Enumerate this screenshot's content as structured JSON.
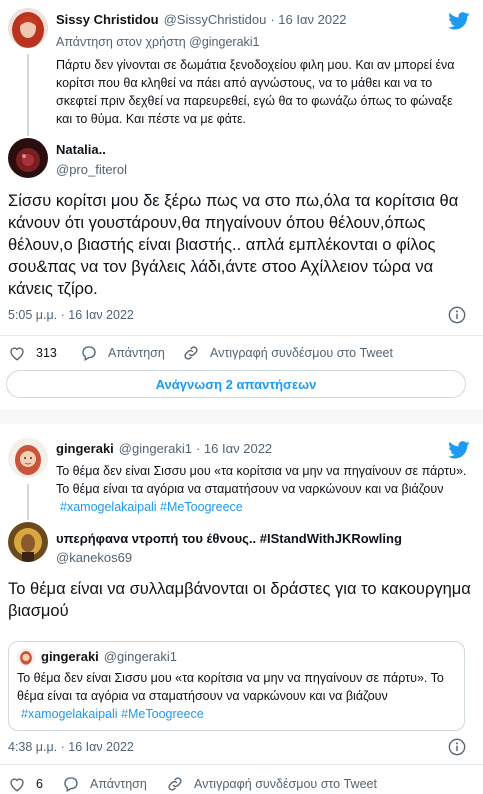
{
  "tweet1": {
    "name": "Sissy Christidou",
    "handle": "@SissyChristidou",
    "date": "· 16 Ιαν 2022",
    "reply_to": "Απάντηση στον χρήστη @gingeraki1",
    "text": "Πάρτυ δεν γίνονται σε δωμάτια ξενοδοχείου φιλη μου. Και αν μπορεί ένα κορίτσι που θα κληθεί να πάει από αγνώστους, να το μάθει και να το σκεφτεί πριν δεχθεί να παρευρεθεί, εγώ θα το φωνάζω όπως το φώναξε και το θύμα. Και πέστε να με φάτε."
  },
  "tweet2": {
    "name": "Natalia..",
    "handle": "@pro_fiterol",
    "text": "Σίσσυ κορίτσι μου δε ξέρω πως να στο πω,όλα τα κορίτσια θα κάνουν ότι γουστάρουν,θα πηγαίνουν όπου θέλουν,όπως θέλουν,ο βιαστής είναι βιαστής.. απλά εμπλέκονται ο φίλος σου&πας να τον βγάλεις λάδι,άντε στοο Αχίλλειον τώρα να κάνεις τζίρο.",
    "timestamp": "5:05 μ.μ. · 16 Ιαν 2022",
    "likes": "313",
    "reply_label": "Απάντηση",
    "copy_label": "Αντιγραφή συνδέσμου στο Tweet",
    "read_replies": "Ανάγνωση 2 απαντήσεων"
  },
  "tweet3": {
    "name": "gingeraki",
    "handle": "@gingeraki1",
    "date": "· 16 Ιαν 2022",
    "text": "Το θέμα δεν είναι Σισσυ μου «τα κορίτσια να μην να πηγαίνουν σε πάρτυ». Το θέμα είναι τα αγόρια να σταματήσουν να ναρκώνουν και να βιάζουν",
    "hashtags": "#xamogelakaipali #MeToogreece"
  },
  "tweet4": {
    "name": "υπερήφανα ντροπή του έθνους.. #IStandWithJKRowling",
    "handle": "@kanekos69",
    "text": "Το θέμα είναι να συλλαμβάνονται οι δράστες για το κακουργημα βιασμού",
    "quote": {
      "name": "gingeraki",
      "handle": "@gingeraki1",
      "text": "Το θέμα δεν είναι Σισσυ μου «τα κορίτσια να μην να πηγαίνουν σε πάρτυ». Το θέμα είναι τα αγόρια να σταματήσουν να ναρκώνουν και να βιάζουν",
      "hashtags": "#xamogelakaipali #MeToogreece"
    },
    "timestamp": "4:38 μ.μ. · 16 Ιαν 2022",
    "likes": "6",
    "reply_label": "Απάντηση",
    "copy_label": "Αντιγραφή συνδέσμου στο Tweet"
  },
  "colors": {
    "accent": "#1d9bf0",
    "twitter_blue": "#1d9bf0",
    "muted": "#536471"
  },
  "icons": [
    "twitter-bird-icon",
    "info-icon",
    "heart-icon",
    "reply-icon",
    "link-icon"
  ]
}
